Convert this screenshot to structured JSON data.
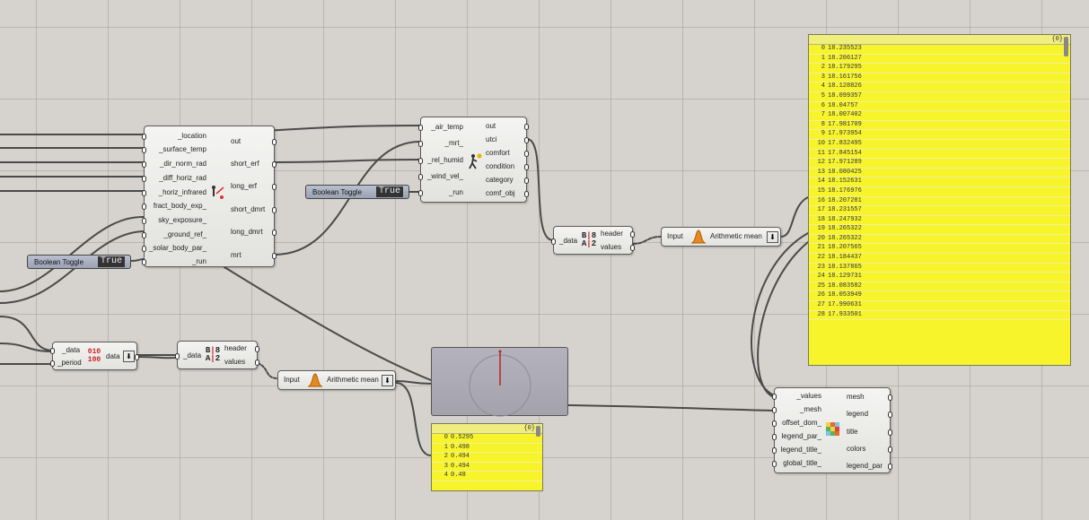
{
  "toggle1": {
    "label": "Boolean Toggle",
    "value": "True"
  },
  "toggle2": {
    "label": "Boolean Toggle",
    "value": "True"
  },
  "comfort_comp": {
    "inputs": [
      "_location",
      "_surface_temp",
      "_dir_norm_rad",
      "_diff_horiz_rad",
      "_horiz_infrared",
      "fract_body_exp_",
      "sky_exposure_",
      "_ground_ref_",
      "_solar_body_par_",
      "_run"
    ],
    "outputs": [
      "out",
      "short_erf",
      "long_erf",
      "short_dmrt",
      "long_dmrt",
      "mrt"
    ]
  },
  "utci_comp": {
    "inputs": [
      "_air_temp",
      "_mrt_",
      "_rel_humid",
      "_wind_vel_",
      "_run"
    ],
    "outputs": [
      "out",
      "utci",
      "comfort",
      "condition",
      "category",
      "comf_obj"
    ]
  },
  "deconstruct_top": {
    "input": "_data",
    "outputs": [
      "header",
      "values"
    ],
    "icon": "B|8 A|2"
  },
  "deconstruct_bottom": {
    "input": "_data",
    "outputs": [
      "header",
      "values"
    ],
    "icon": "B|8 A|2"
  },
  "period_comp": {
    "inputs": [
      "_data",
      "_period"
    ],
    "output": "data",
    "icon": "010 100"
  },
  "mean_top": {
    "input": "Input",
    "label": "Arithmetic mean"
  },
  "mean_bottom": {
    "input": "Input",
    "label": "Arithmetic mean"
  },
  "legend_comp": {
    "inputs": [
      "_values",
      "_mesh",
      "offset_dom_",
      "legend_par_",
      "legend_title_",
      "global_title_"
    ],
    "outputs": [
      "mesh",
      "legend",
      "title",
      "colors",
      "legend_par"
    ]
  },
  "panel_big": {
    "header": "{0}",
    "rows": [
      {
        "i": "0",
        "v": "18.235523"
      },
      {
        "i": "1",
        "v": "18.206127"
      },
      {
        "i": "2",
        "v": "18.179295"
      },
      {
        "i": "3",
        "v": "18.161756"
      },
      {
        "i": "4",
        "v": "18.128826"
      },
      {
        "i": "5",
        "v": "18.099357"
      },
      {
        "i": "6",
        "v": "18.04757"
      },
      {
        "i": "7",
        "v": "18.007402"
      },
      {
        "i": "8",
        "v": "17.981709"
      },
      {
        "i": "9",
        "v": "17.973954"
      },
      {
        "i": "10",
        "v": "17.832495"
      },
      {
        "i": "11",
        "v": "17.845154"
      },
      {
        "i": "12",
        "v": "17.971289"
      },
      {
        "i": "13",
        "v": "18.080425"
      },
      {
        "i": "14",
        "v": "18.152631"
      },
      {
        "i": "15",
        "v": "18.176976"
      },
      {
        "i": "16",
        "v": "18.207281"
      },
      {
        "i": "17",
        "v": "18.231557"
      },
      {
        "i": "18",
        "v": "18.247932"
      },
      {
        "i": "19",
        "v": "18.265322"
      },
      {
        "i": "20",
        "v": "18.265322"
      },
      {
        "i": "21",
        "v": "18.207565"
      },
      {
        "i": "22",
        "v": "18.184437"
      },
      {
        "i": "23",
        "v": "18.137865"
      },
      {
        "i": "24",
        "v": "18.129731"
      },
      {
        "i": "25",
        "v": "18.083582"
      },
      {
        "i": "26",
        "v": "18.053949"
      },
      {
        "i": "27",
        "v": "17.990631"
      },
      {
        "i": "28",
        "v": "17.933501"
      }
    ]
  },
  "panel_small": {
    "header": "{0}",
    "rows": [
      {
        "i": "0",
        "v": "0.5295"
      },
      {
        "i": "1",
        "v": "0.498"
      },
      {
        "i": "2",
        "v": "0.494"
      },
      {
        "i": "3",
        "v": "0.494"
      },
      {
        "i": "4",
        "v": "0.48"
      }
    ]
  },
  "colors": {
    "canvas": "#d6d3ce",
    "panel": "#f7f42c",
    "wire": "#4a4a4a",
    "dial": "#a9a8b3"
  }
}
